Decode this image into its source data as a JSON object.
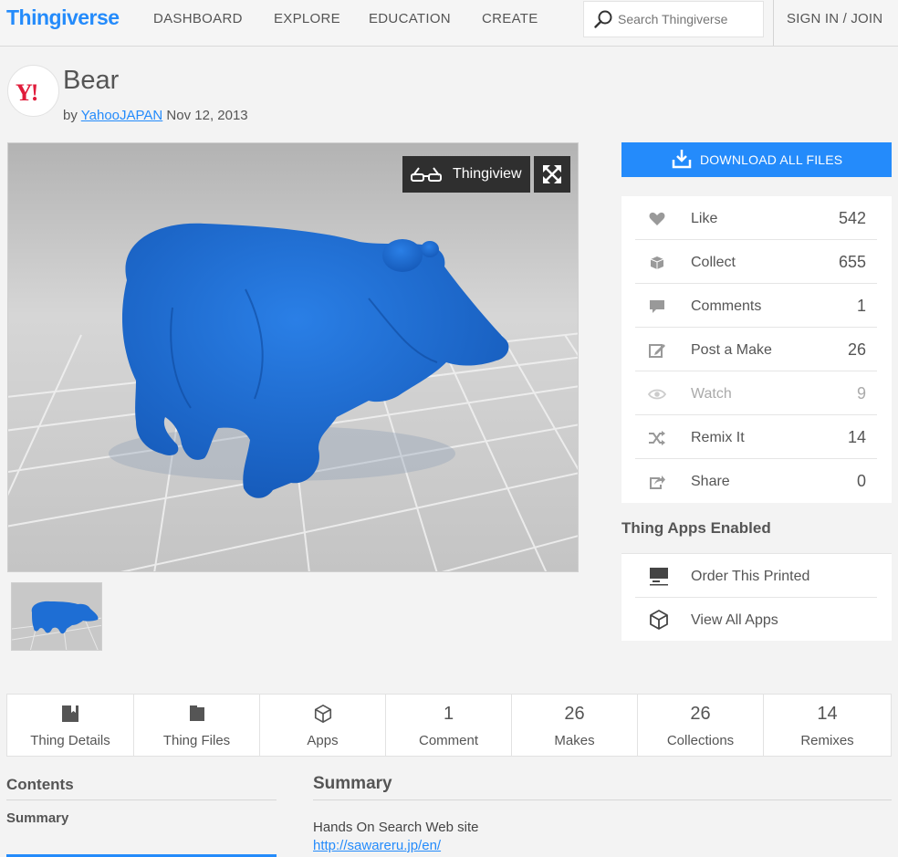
{
  "nav": {
    "logo": "Thingiverse",
    "links": [
      "DASHBOARD",
      "EXPLORE",
      "EDUCATION",
      "CREATE"
    ],
    "search_placeholder": "Search Thingiverse",
    "signin": "SIGN IN / JOIN"
  },
  "thing": {
    "avatar_text": "Y!",
    "title": "Bear",
    "by": "by",
    "author": "YahooJAPAN",
    "date": "Nov 12, 2013"
  },
  "viewer": {
    "thingiview_label": "Thingiview"
  },
  "actions": {
    "download_label": "DOWNLOAD ALL FILES",
    "stats": [
      {
        "icon": "heart-icon",
        "label": "Like",
        "count": "542"
      },
      {
        "icon": "collect-icon",
        "label": "Collect",
        "count": "655"
      },
      {
        "icon": "comment-icon",
        "label": "Comments",
        "count": "1"
      },
      {
        "icon": "post-make-icon",
        "label": "Post a Make",
        "count": "26"
      },
      {
        "icon": "eye-icon",
        "label": "Watch",
        "count": "9"
      },
      {
        "icon": "remix-icon",
        "label": "Remix It",
        "count": "14"
      },
      {
        "icon": "share-icon",
        "label": "Share",
        "count": "0"
      }
    ],
    "apps_heading": "Thing Apps Enabled",
    "apps": [
      {
        "icon": "printer-icon",
        "label": "Order This Printed"
      },
      {
        "icon": "cube-icon",
        "label": "View All Apps"
      }
    ]
  },
  "tabs": [
    {
      "icon": "book-icon",
      "num": "",
      "label": "Thing Details"
    },
    {
      "icon": "folder-icon",
      "num": "",
      "label": "Thing Files"
    },
    {
      "icon": "cube-icon",
      "num": "",
      "label": "Apps"
    },
    {
      "icon": "",
      "num": "1",
      "label": "Comment"
    },
    {
      "icon": "",
      "num": "26",
      "label": "Makes"
    },
    {
      "icon": "",
      "num": "26",
      "label": "Collections"
    },
    {
      "icon": "",
      "num": "14",
      "label": "Remixes"
    }
  ],
  "contents": {
    "heading": "Contents",
    "items": [
      "Summary"
    ]
  },
  "summary": {
    "heading": "Summary",
    "text": "Hands On Search Web site",
    "link": "http://sawareru.jp/en/"
  },
  "colors": {
    "brand": "#248bfb",
    "model": "#1e6ed4",
    "dark_button": "#2f2f2f"
  }
}
